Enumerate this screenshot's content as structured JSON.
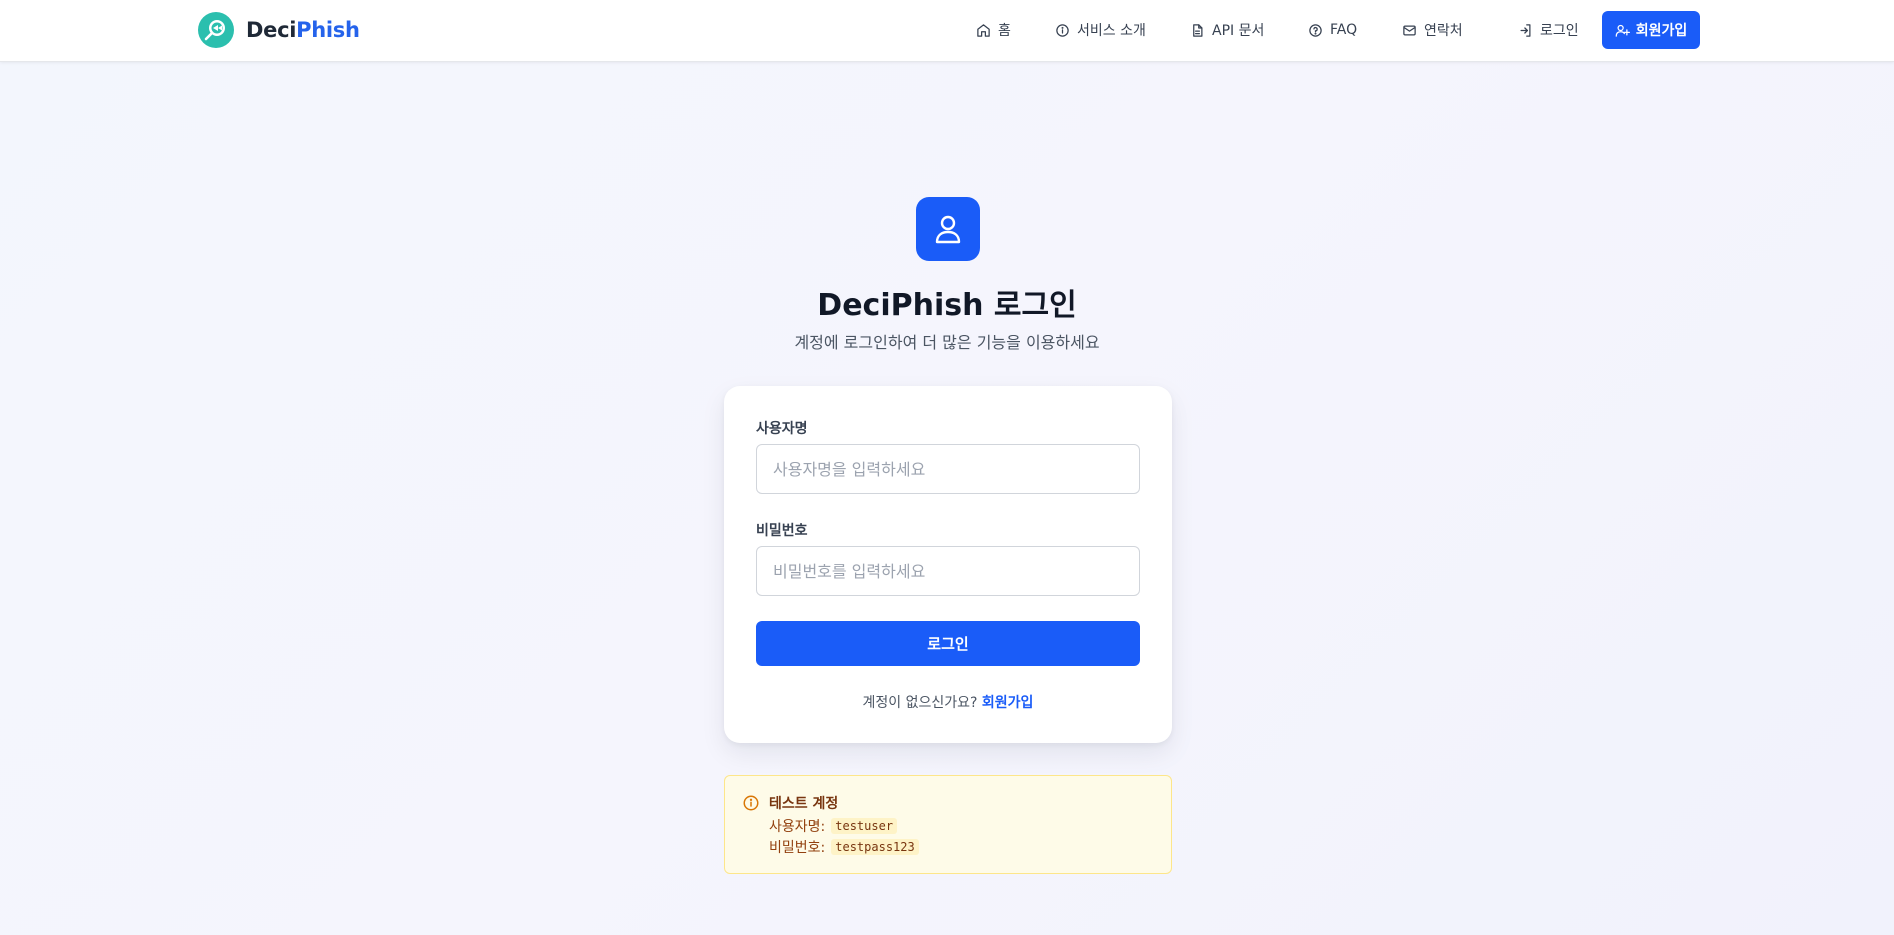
{
  "header": {
    "logo_part1": "Deci",
    "logo_part2": "Phish",
    "nav": [
      {
        "label": "홈",
        "icon": "home-icon"
      },
      {
        "label": "서비스 소개",
        "icon": "info-icon"
      },
      {
        "label": "API 문서",
        "icon": "document-icon"
      },
      {
        "label": "FAQ",
        "icon": "help-circle-icon"
      },
      {
        "label": "연락처",
        "icon": "mail-icon"
      },
      {
        "label": "로그인",
        "icon": "login-icon"
      }
    ],
    "signup_label": "회원가입"
  },
  "hero": {
    "icon": "user-icon",
    "title": "DeciPhish 로그인",
    "subtitle": "계정에 로그인하여 더 많은 기능을 이용하세요"
  },
  "form": {
    "username_label": "사용자명",
    "username_placeholder": "사용자명을 입력하세요",
    "username_value": "",
    "password_label": "비밀번호",
    "password_placeholder": "비밀번호를 입력하세요",
    "password_value": "",
    "submit_label": "로그인",
    "footer_text": "계정이 없으신가요?",
    "footer_link": "회원가입"
  },
  "test_account": {
    "icon": "info-icon",
    "title": "테스트 계정",
    "username_label": "사용자명:",
    "username": "testuser",
    "password_label": "비밀번호:",
    "password": "testpass123"
  },
  "colors": {
    "primary": "#1a5cf8",
    "brand_teal": "#2bbfae",
    "warning_bg": "#fefbe8",
    "warning_border": "#fde68a"
  }
}
